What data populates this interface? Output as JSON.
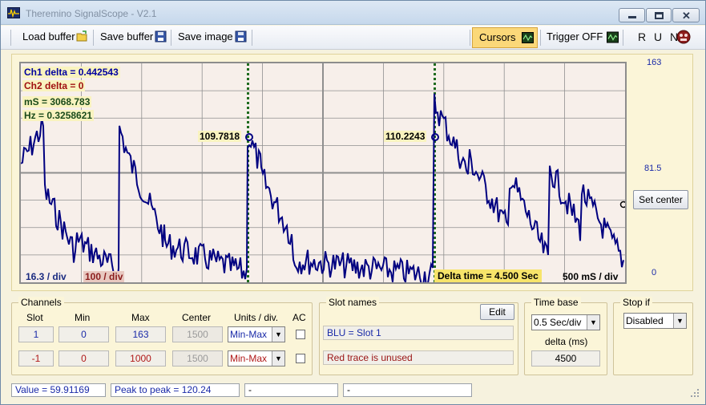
{
  "window": {
    "title": "Theremino SignalScope - V2.1"
  },
  "toolbar": {
    "load_buffer": "Load buffer",
    "save_buffer": "Save buffer",
    "save_image": "Save image",
    "cursors": "Cursors",
    "trigger": "Trigger OFF",
    "run": "R U N"
  },
  "scope": {
    "ch1_delta": "Ch1 delta = 0.442543",
    "ch2_delta": "Ch2 delta = 0",
    "ms": "mS = 3068.783",
    "hz": "Hz = 0.3258621",
    "cursor1_value": "109.7818",
    "cursor2_value": "110.2243",
    "ch1_div": "16.3 / div",
    "ch2_div": "100 / div",
    "delta_time": "Delta time = 4.500 Sec",
    "time_div": "500 mS / div",
    "y_top": "163",
    "y_mid": "81.5",
    "y_bottom": "0",
    "set_center": "Set center"
  },
  "colors": {
    "trace": "#000080",
    "cursor": "#1f6b1f",
    "grid": "#8f8f8f",
    "screen_bg": "#f7efea",
    "ch1": "#0000a0",
    "ch2": "#c00000"
  },
  "channels": {
    "title": "Channels",
    "headers": {
      "slot": "Slot",
      "min": "Min",
      "max": "Max",
      "center": "Center",
      "units": "Units / div.",
      "ac": "AC"
    },
    "rows": [
      {
        "slot": "1",
        "min": "0",
        "max": "163",
        "center": "1500",
        "units": "Min-Max"
      },
      {
        "slot": "-1",
        "min": "0",
        "max": "1000",
        "center": "1500",
        "units": "Min-Max"
      }
    ]
  },
  "slot_names": {
    "title": "Slot names",
    "edit": "Edit",
    "row1": "BLU = Slot 1",
    "row2": "Red trace is unused"
  },
  "time_base": {
    "title": "Time base",
    "value": "0.5 Sec/div",
    "delta_label": "delta (ms)",
    "delta_value": "4500"
  },
  "stop_if": {
    "title": "Stop if",
    "value": "Disabled"
  },
  "statusbar": {
    "value": "Value = 59.91169",
    "peak": "Peak to peak = 120.24",
    "f3": "-",
    "f4": "-"
  }
}
